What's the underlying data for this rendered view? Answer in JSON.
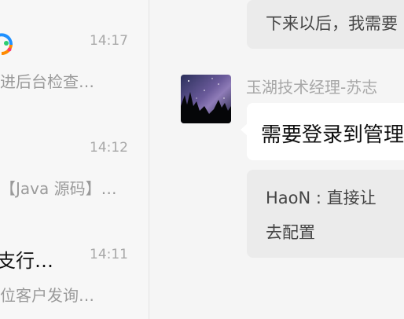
{
  "chat_list": [
    {
      "title": "",
      "time": "14:17",
      "preview": "进后台检查…",
      "has_logo": true
    },
    {
      "title": "",
      "time": "14:12",
      "preview": "【Java 源码】…"
    },
    {
      "title": "支行…",
      "time": "14:11",
      "preview": "位客户发询…"
    }
  ],
  "conversation": {
    "top_message": "下来以后，我需要",
    "sender": "玉湖技术经理-苏志",
    "message": "需要登录到管理",
    "quote": {
      "author": "HaoN ",
      "apple_glyph": "",
      "text": ": 直接让",
      "line2": "去配置"
    }
  },
  "colors": {
    "accent_logo_blue": "#1e90ff",
    "accent_logo_orange": "#ff8a00",
    "accent_logo_green": "#2ecc71"
  }
}
